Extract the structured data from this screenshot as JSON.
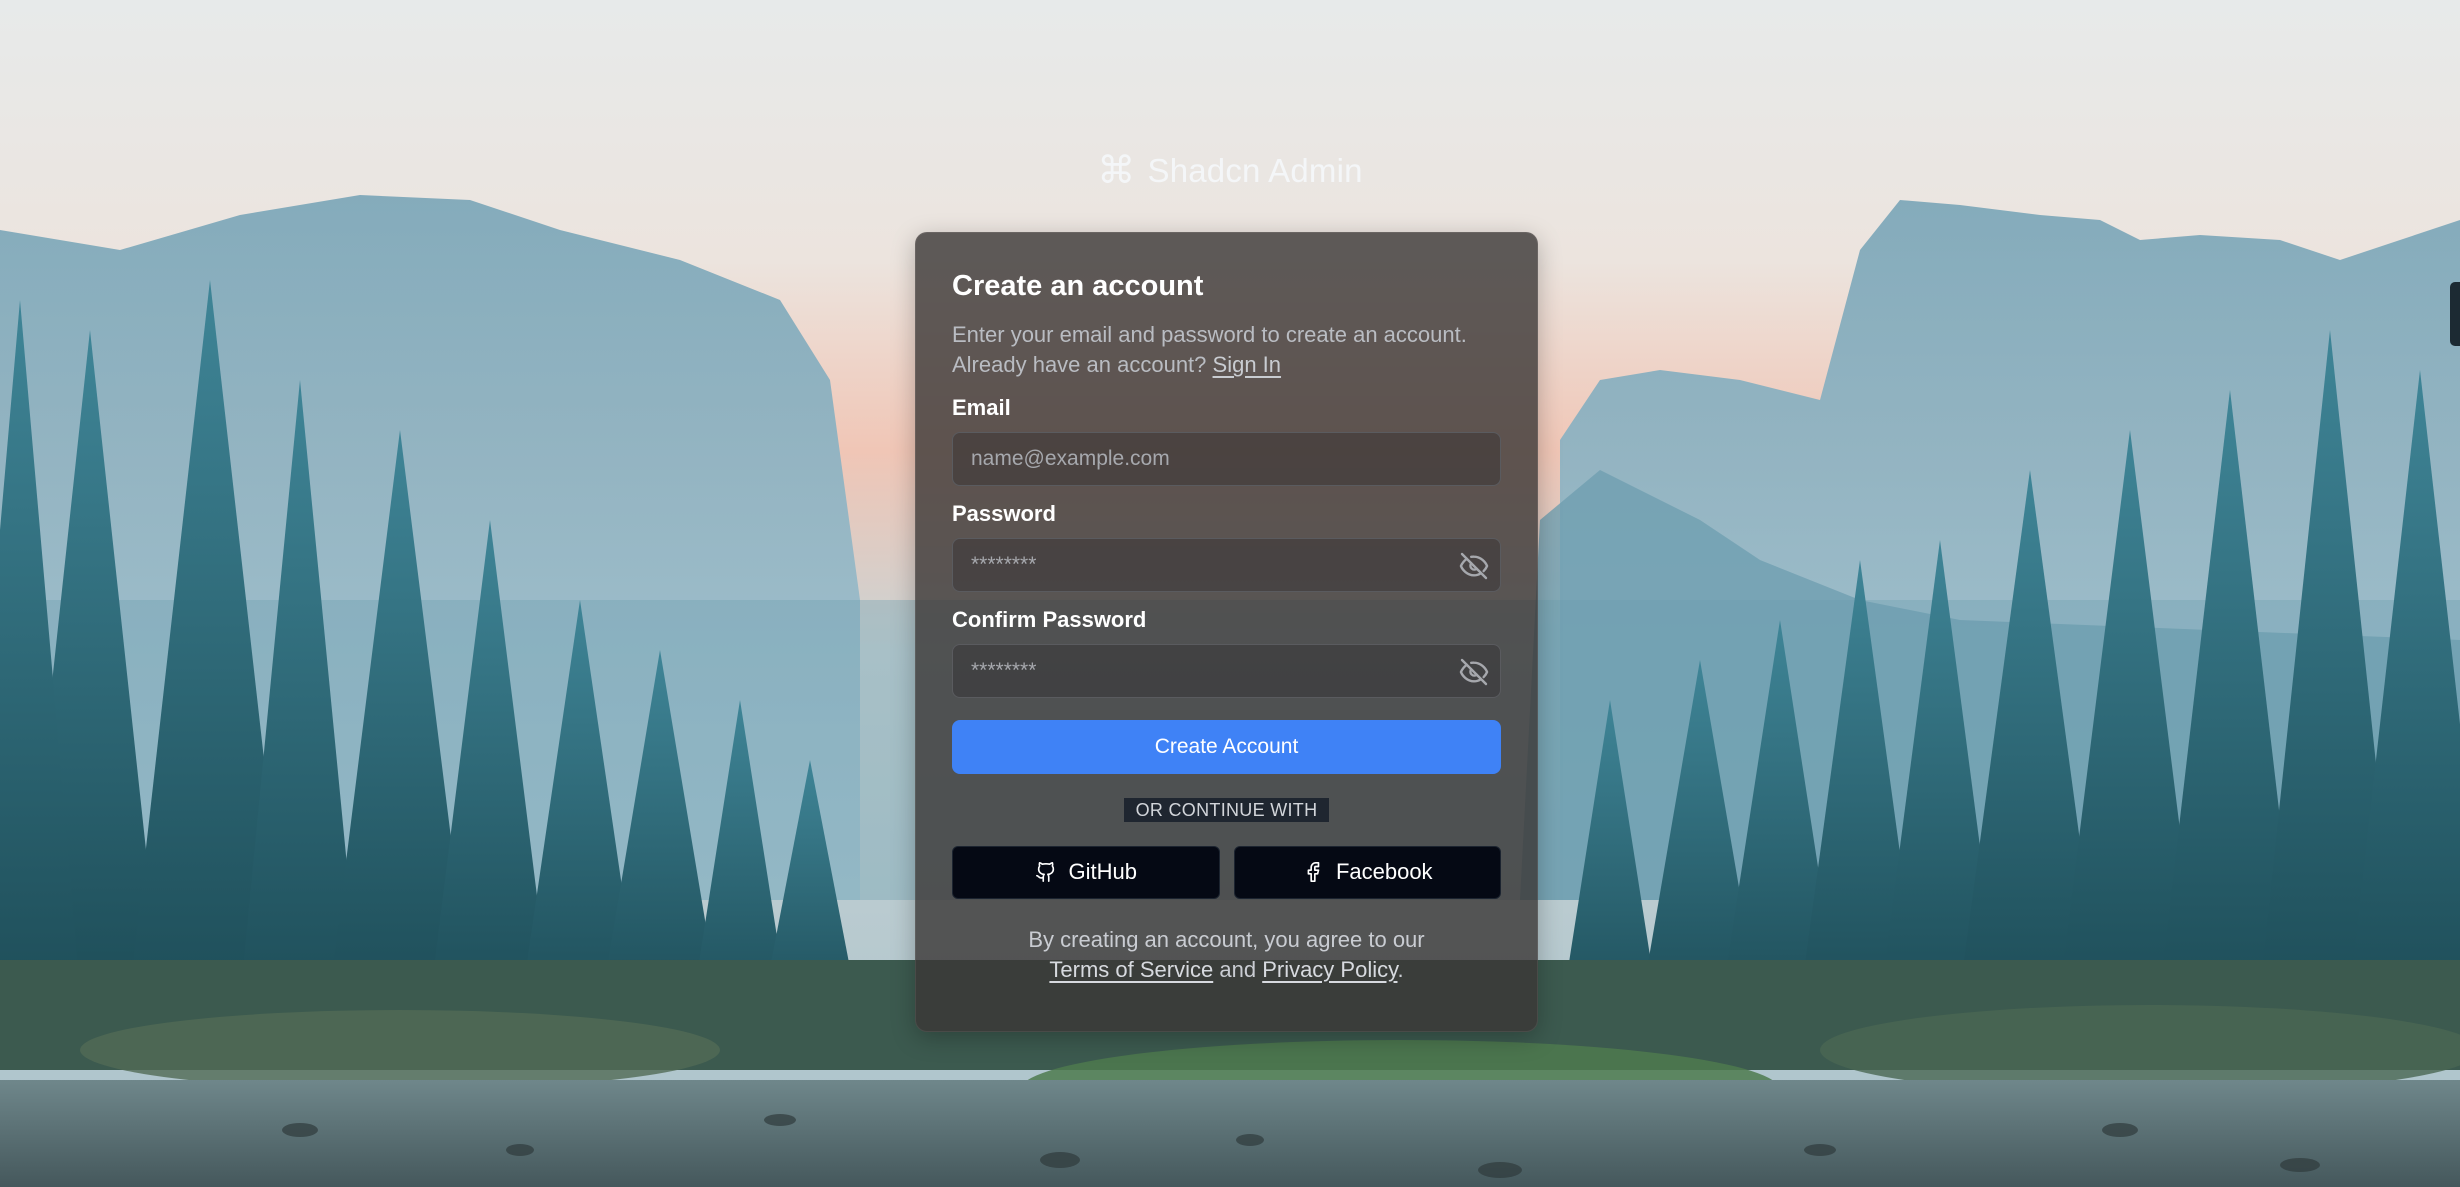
{
  "brand": {
    "name": "Shadcn Admin",
    "icon": "command-icon"
  },
  "card": {
    "title": "Create an account",
    "desc_line1": "Enter your email and password to create an account.",
    "desc_prefix": "Already have an account?",
    "sign_in": "Sign In"
  },
  "form": {
    "email_label": "Email",
    "email_placeholder": "name@example.com",
    "password_label": "Password",
    "password_placeholder": "********",
    "confirm_label": "Confirm Password",
    "confirm_placeholder": "********",
    "toggle_icon": "eye-off-icon",
    "submit_label": "Create Account"
  },
  "divider": {
    "label": "OR CONTINUE WITH"
  },
  "socials": [
    {
      "label": "GitHub",
      "icon": "github-icon"
    },
    {
      "label": "Facebook",
      "icon": "facebook-icon"
    }
  ],
  "terms": {
    "prefix": "By creating an account, you agree to our",
    "tos": "Terms of Service",
    "and": "and",
    "privacy": "Privacy Policy",
    "suffix": "."
  },
  "colors": {
    "accent": "#3f82f6",
    "social_bg": "#050914",
    "card_bg": "rgba(58,54,52,0.80)"
  }
}
